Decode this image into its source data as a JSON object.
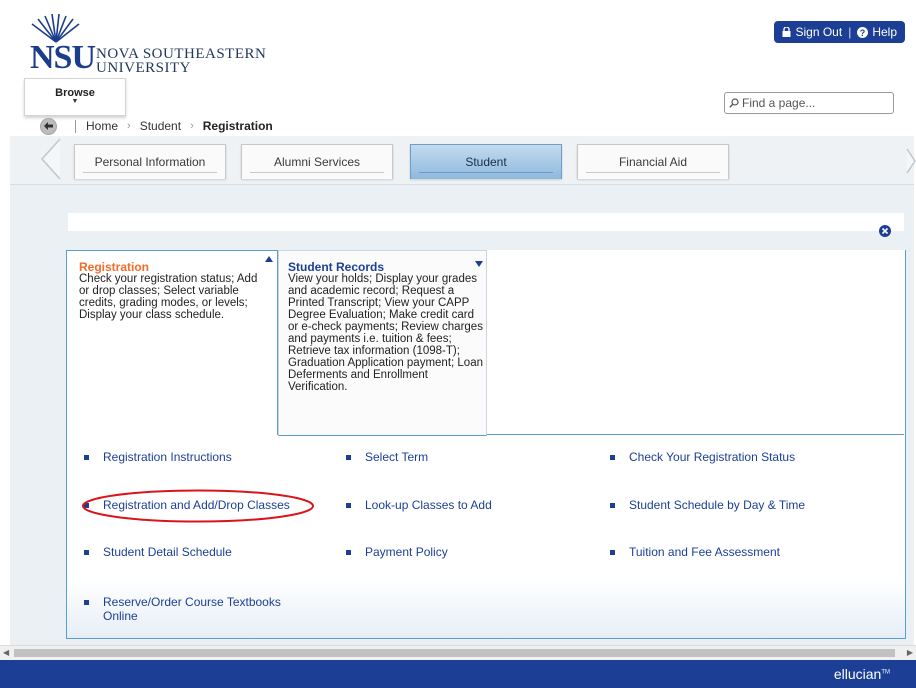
{
  "logo": {
    "mark": "NSU",
    "line1": "NOVA SOUTHEASTERN",
    "line2": "UNIVERSITY"
  },
  "auth": {
    "sign_out": "Sign Out",
    "help": "Help"
  },
  "browse": {
    "label": "Browse"
  },
  "search": {
    "placeholder": "Find a page..."
  },
  "breadcrumb": {
    "items": [
      "Home",
      "Student",
      "Registration"
    ]
  },
  "tabs": [
    {
      "label": "Personal Information"
    },
    {
      "label": "Alumni Services"
    },
    {
      "label": "Student"
    },
    {
      "label": "Financial Aid"
    }
  ],
  "menus": {
    "registration": {
      "title": "Registration",
      "description": "Check your registration status; Add or drop classes; Select variable credits, grading modes, or levels; Display your class schedule."
    },
    "student_records": {
      "title": "Student Records",
      "description": "View your holds; Display your grades and academic record; Request a Printed Transcript; View your CAPP Degree Evaluation; Make credit card or e-check payments; Review charges and payments i.e. tuition & fees; Retrieve tax information (1098-T); Graduation Application payment; Loan Deferments and Enrollment Verification."
    }
  },
  "links": {
    "col1": [
      "Registration Instructions",
      "Registration and Add/Drop Classes",
      "Student Detail Schedule",
      "Reserve/Order Course Textbooks Online"
    ],
    "col2": [
      "Select Term",
      "Look-up Classes to Add",
      "Payment Policy"
    ],
    "col3": [
      "Check Your Registration Status",
      "Student Schedule by Day & Time",
      "Tuition and Fee Assessment"
    ]
  },
  "footer": {
    "brand": "ellucian",
    "mark": "TM"
  },
  "colors": {
    "brand_blue": "#1c3f95",
    "accent_orange": "#f26c2a",
    "highlight_circle": "#d9141b",
    "active_tab": "#8fb9de"
  }
}
